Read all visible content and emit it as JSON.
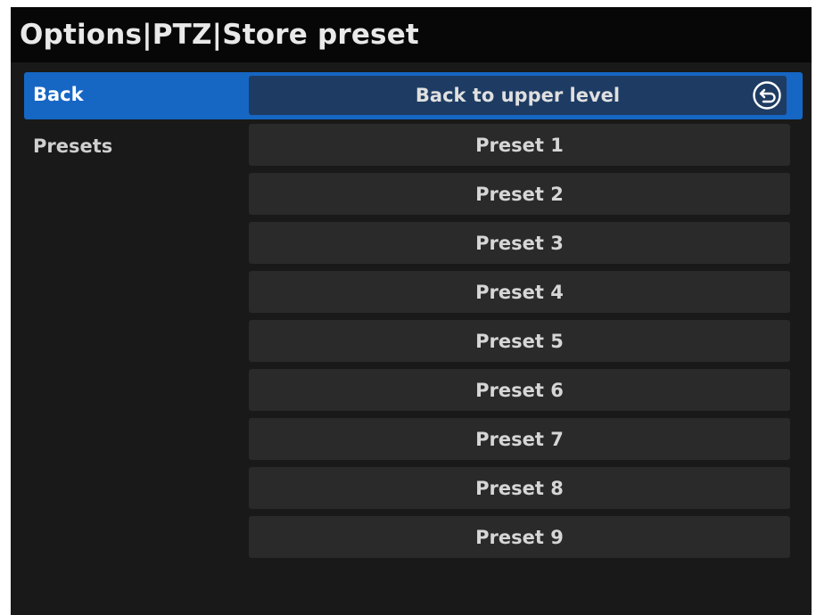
{
  "header": {
    "title": "Options|PTZ|Store preset"
  },
  "back_row": {
    "label": "Back",
    "button_label": "Back to upper level",
    "icon": "return-arrow-icon"
  },
  "presets": {
    "label": "Presets",
    "items": [
      {
        "label": "Preset 1"
      },
      {
        "label": "Preset 2"
      },
      {
        "label": "Preset 3"
      },
      {
        "label": "Preset 4"
      },
      {
        "label": "Preset 5"
      },
      {
        "label": "Preset 6"
      },
      {
        "label": "Preset 7"
      },
      {
        "label": "Preset 8"
      },
      {
        "label": "Preset 9"
      }
    ]
  },
  "colors": {
    "selection": "#1666c4",
    "selected_button": "#1e3c63",
    "background": "#191919",
    "title_bar": "#070707",
    "button": "#2a2a2a"
  }
}
